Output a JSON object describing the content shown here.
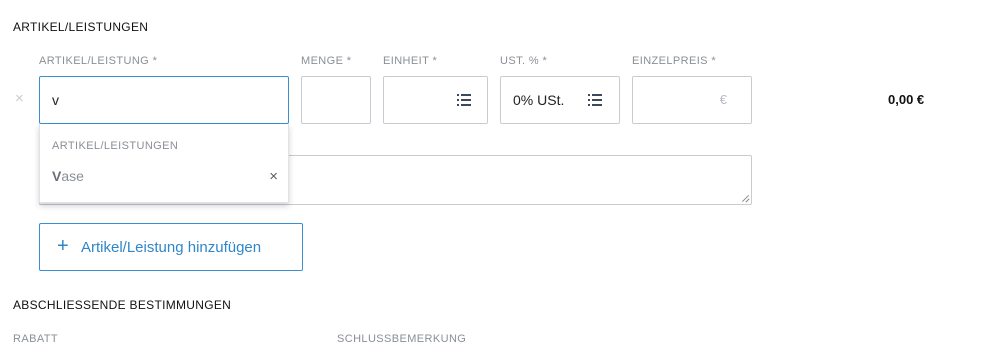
{
  "sections": {
    "items_title": "ARTIKEL/LEISTUNGEN",
    "closing_title": "ABSCHLIESSENDE BESTIMMUNGEN"
  },
  "columns": {
    "item": "ARTIKEL/LEISTUNG *",
    "quantity": "MENGE *",
    "unit": "EINHEIT *",
    "vat": "UST. % *",
    "unit_price": "EINZELPREIS *"
  },
  "line": {
    "remove_symbol": "×",
    "item_value": "v",
    "quantity_value": "",
    "unit_value": "",
    "vat_value": "0% USt.",
    "price_value": "",
    "currency_symbol": "€",
    "total": "0,00 €"
  },
  "dropdown": {
    "header": "ARTIKEL/LEISTUNGEN",
    "option_match": "V",
    "option_rest": "ase",
    "option_remove_symbol": "×"
  },
  "add_button": {
    "icon": "+",
    "label": "Artikel/Leistung hinzufügen"
  },
  "closing": {
    "discount_label": "RABATT",
    "final_note_label": "SCHLUSSBEMERKUNG"
  },
  "icons": {
    "list": "list-icon",
    "close": "close-icon",
    "plus": "plus-icon"
  },
  "colors": {
    "accent": "#3b8fd0",
    "border": "#c7ccd1",
    "muted": "#8a8f96"
  }
}
